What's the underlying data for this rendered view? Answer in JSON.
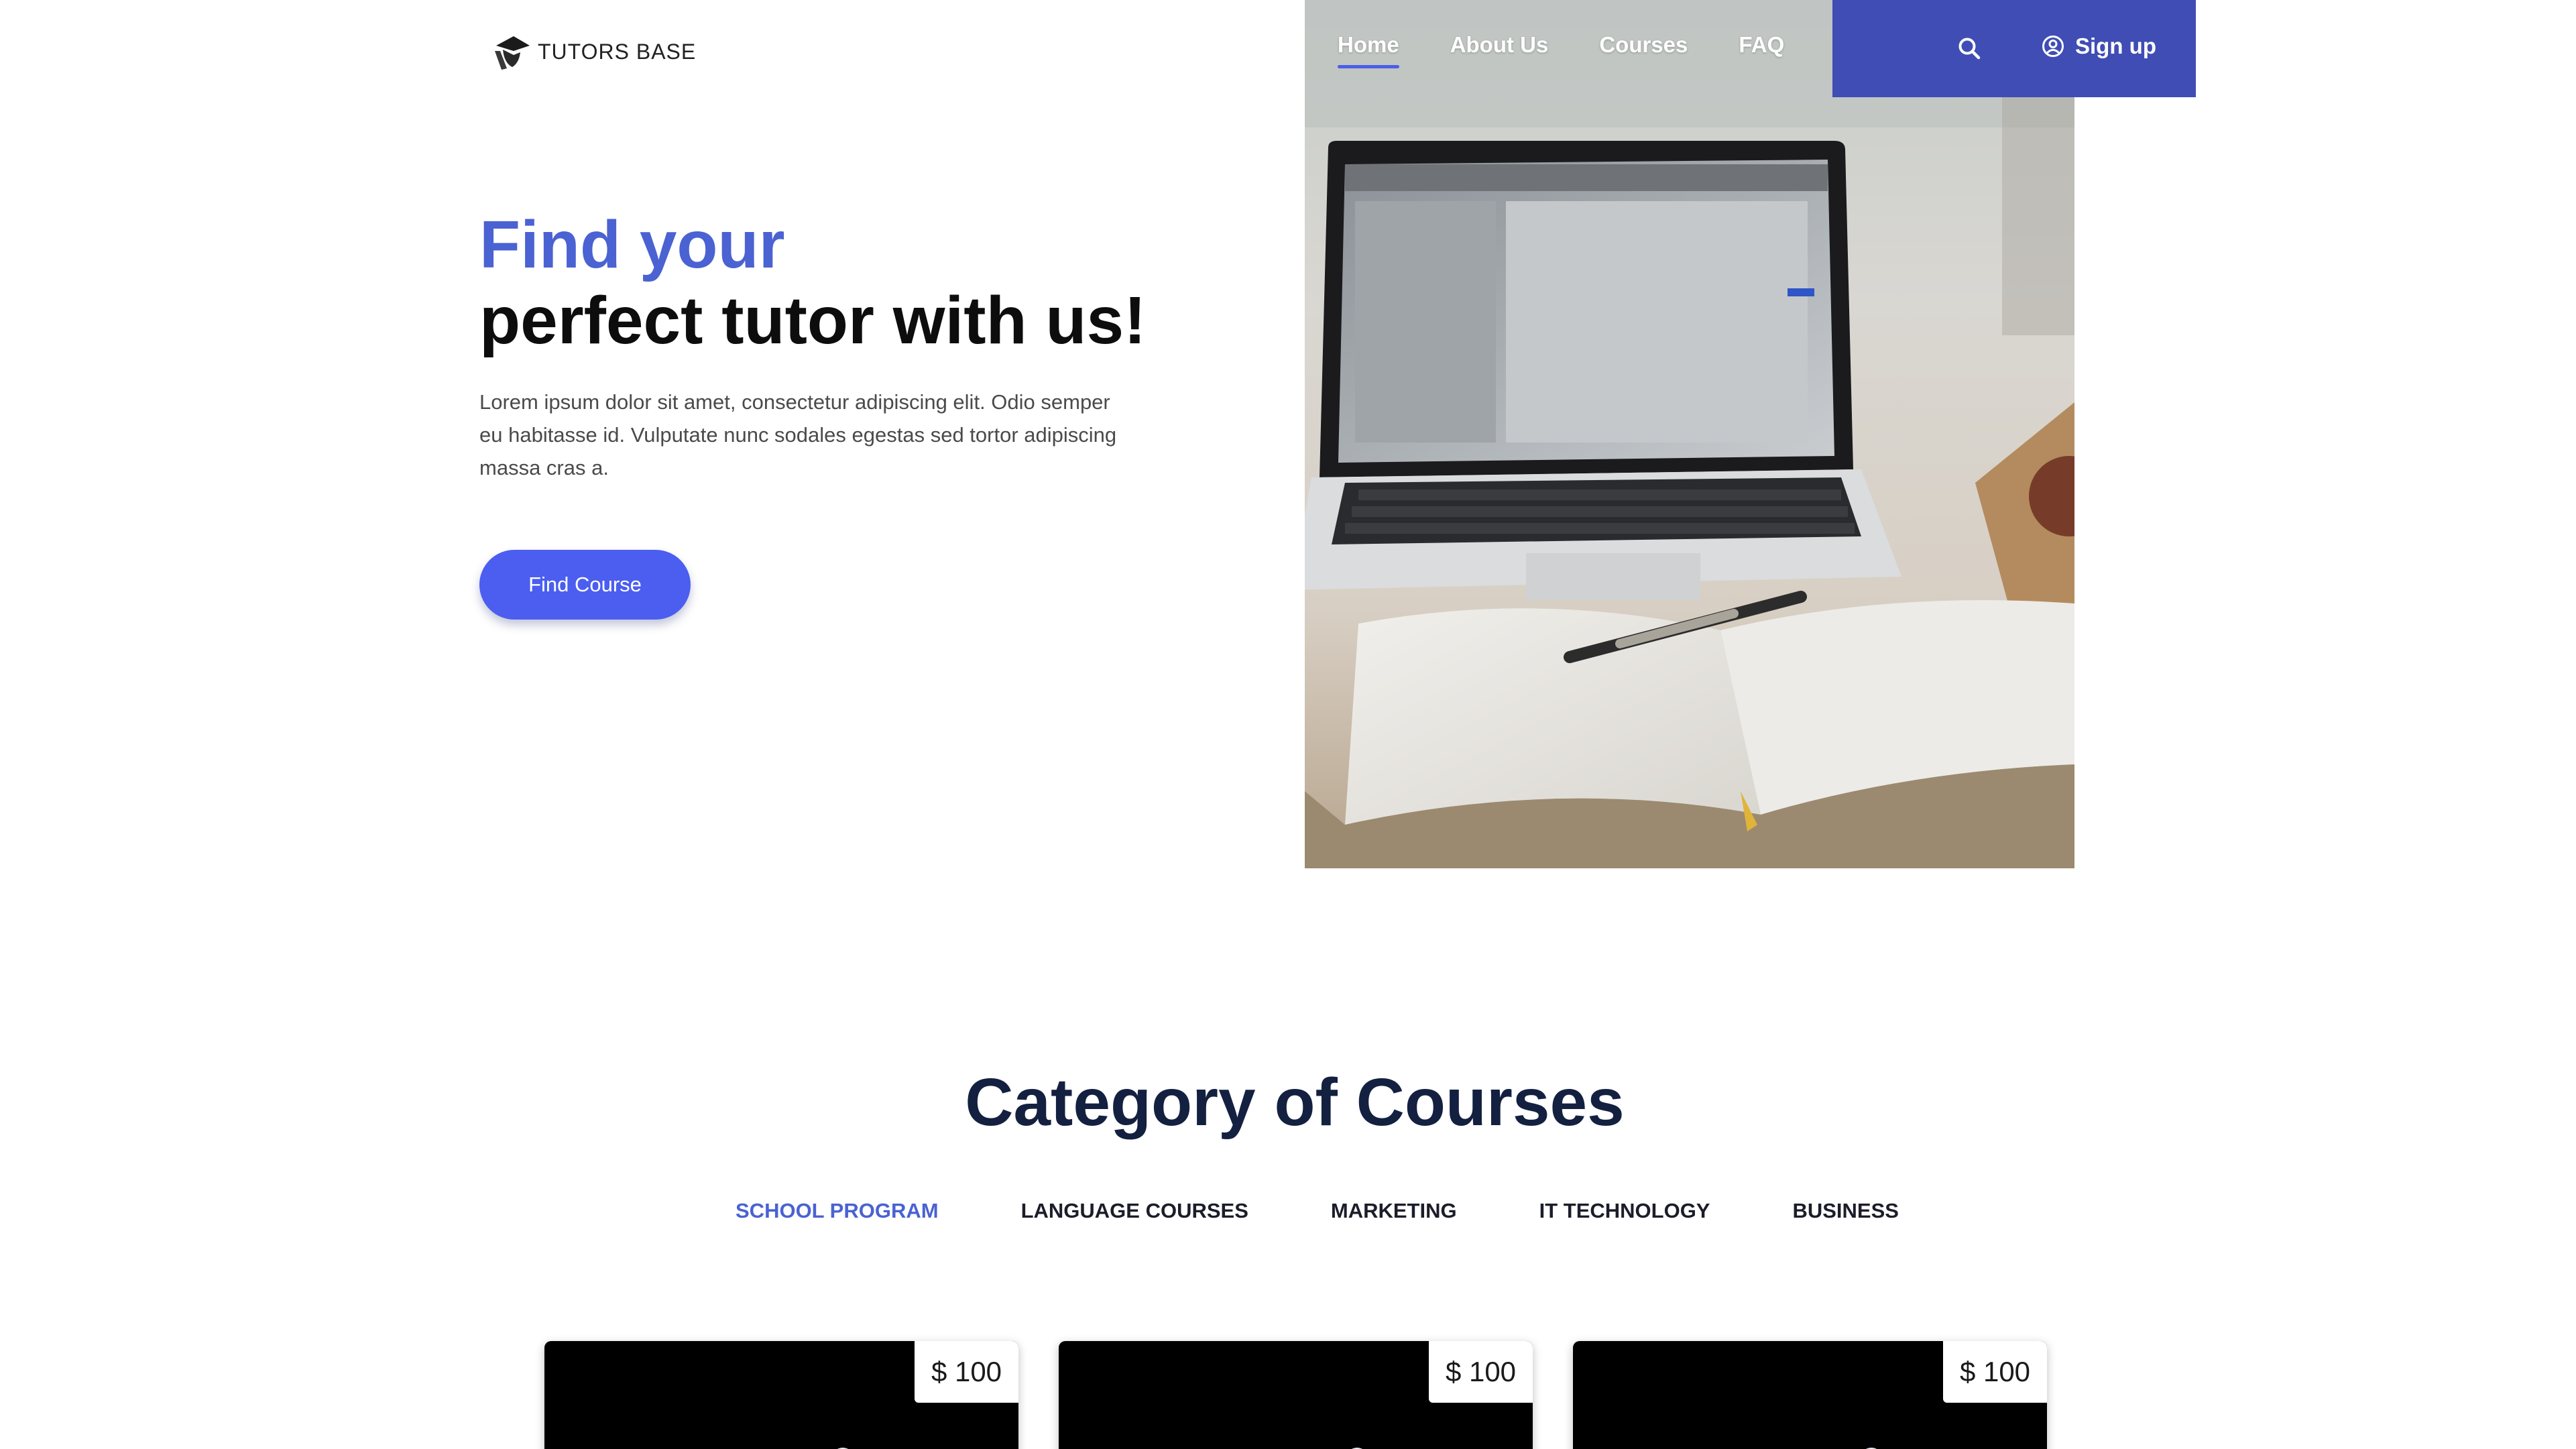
{
  "brand": {
    "name": "TUTORS BASE",
    "logo_icon": "graduate-silhouette-icon"
  },
  "nav": {
    "items": [
      {
        "label": "Home",
        "active": true
      },
      {
        "label": "About Us",
        "active": false
      },
      {
        "label": "Courses",
        "active": false
      },
      {
        "label": "FAQ",
        "active": false
      }
    ],
    "search_icon": "search-icon",
    "signup_label": "Sign up",
    "signup_icon": "user-circle-icon",
    "bar_color": "#3f4db5"
  },
  "hero": {
    "title_line1": "Find your",
    "title_line2": "perfect tutor with us!",
    "description": "Lorem ipsum dolor sit amet, consectetur adipiscing elit. Odio semper eu habitasse id. Vulputate nunc sodales egestas sed tortor adipiscing massa cras a.",
    "cta_label": "Find Course",
    "accent_color": "#4a62d2",
    "button_color": "#4b5ef0"
  },
  "categories": {
    "title": "Category of Courses",
    "tabs": [
      {
        "label": "SCHOOL PROGRAM",
        "active": true
      },
      {
        "label": "LANGUAGE COURSES",
        "active": false
      },
      {
        "label": "MARKETING",
        "active": false
      },
      {
        "label": "IT TECHNOLOGY",
        "active": false
      },
      {
        "label": "BUSINESS",
        "active": false
      }
    ]
  },
  "courses": [
    {
      "price": "$ 100",
      "image_icon": "molecule-icon"
    },
    {
      "price": "$ 100",
      "image_icon": "molecule-icon"
    },
    {
      "price": "$ 100",
      "image_icon": "molecule-icon"
    }
  ]
}
